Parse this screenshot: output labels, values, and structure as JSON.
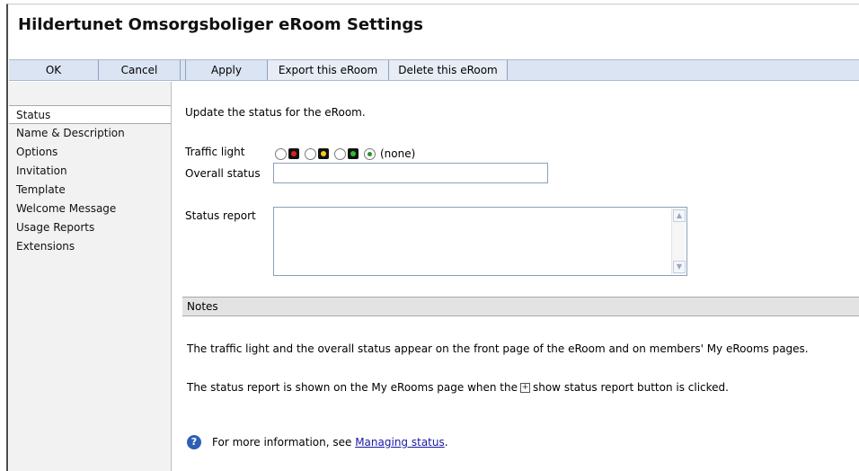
{
  "page": {
    "title": "Hildertunet Omsorgsboliger eRoom Settings"
  },
  "toolbar": {
    "ok": "OK",
    "cancel": "Cancel",
    "apply": "Apply",
    "export": "Export this eRoom",
    "delete": "Delete this eRoom"
  },
  "sidebar": {
    "items": [
      {
        "label": "Status",
        "active": true
      },
      {
        "label": "Name & Description"
      },
      {
        "label": "Options"
      },
      {
        "label": "Invitation"
      },
      {
        "label": "Template"
      },
      {
        "label": "Welcome Message"
      },
      {
        "label": "Usage Reports"
      },
      {
        "label": "Extensions"
      }
    ]
  },
  "status": {
    "intro": "Update the status for the eRoom.",
    "traffic_label": "Traffic light",
    "traffic_options": [
      "red-light-icon",
      "yellow-light-icon",
      "green-light-icon"
    ],
    "none_label": "(none)",
    "selected": "none",
    "overall_label": "Overall status",
    "overall_value": "",
    "report_label": "Status report",
    "report_value": ""
  },
  "notes": {
    "header": "Notes",
    "line1": "The traffic light and the overall status appear on the front page of the eRoom and on members' My eRooms pages.",
    "line2_before": "The status report is shown on the My eRooms page when the",
    "line2_after": "show status report button is clicked.",
    "more_prefix": "For more information, see",
    "more_link": "Managing status",
    "more_suffix": "."
  },
  "colors": {
    "toolbar_bg": "#dbe4f2",
    "sidebar_bg": "#f2f2f2",
    "notes_bg": "#e3e3e3",
    "link": "#1a1aa6"
  }
}
